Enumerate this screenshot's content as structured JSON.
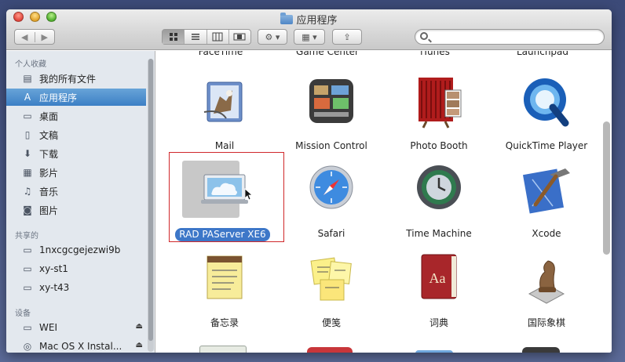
{
  "window": {
    "title": "应用程序"
  },
  "toolbar": {
    "back_glyph": "◀",
    "forward_glyph": "▶",
    "view_icons": [
      "icon-view-icon",
      "list-view-icon",
      "column-view-icon",
      "coverflow-view-icon"
    ],
    "action_glyph": "⚙ ▾",
    "arrange_glyph": "▦ ▾",
    "share_glyph": "⇪",
    "search_placeholder": ""
  },
  "sidebar": {
    "favorites_header": "个人收藏",
    "shared_header": "共享的",
    "devices_header": "设备",
    "items": [
      {
        "label": "我的所有文件",
        "icon": "all-files-icon"
      },
      {
        "label": "应用程序",
        "icon": "applications-icon"
      },
      {
        "label": "桌面",
        "icon": "desktop-icon"
      },
      {
        "label": "文稿",
        "icon": "documents-icon"
      },
      {
        "label": "下载",
        "icon": "downloads-icon"
      },
      {
        "label": "影片",
        "icon": "movies-icon"
      },
      {
        "label": "音乐",
        "icon": "music-icon"
      },
      {
        "label": "图片",
        "icon": "pictures-icon"
      }
    ],
    "shared": [
      {
        "label": "1nxcgcgejezwi9b",
        "icon": "computer-icon"
      },
      {
        "label": "xy-st1",
        "icon": "computer-icon"
      },
      {
        "label": "xy-t43",
        "icon": "computer-icon"
      }
    ],
    "devices": [
      {
        "label": "WEI",
        "icon": "disk-icon"
      },
      {
        "label": "Mac OS X Instal...",
        "icon": "dvd-icon"
      }
    ]
  },
  "content": {
    "cut_labels": [
      "FaceTime",
      "Game Center",
      "iTunes",
      "Launchpad"
    ],
    "apps": [
      {
        "label": "Mail",
        "icon": "mail-icon"
      },
      {
        "label": "Mission Control",
        "icon": "mission-control-icon"
      },
      {
        "label": "Photo Booth",
        "icon": "photo-booth-icon"
      },
      {
        "label": "QuickTime Player",
        "icon": "quicktime-icon"
      },
      {
        "label": "RAD PAServer XE6",
        "icon": "paserver-icon"
      },
      {
        "label": "Safari",
        "icon": "safari-icon"
      },
      {
        "label": "Time Machine",
        "icon": "time-machine-icon"
      },
      {
        "label": "Xcode",
        "icon": "xcode-icon"
      },
      {
        "label": "备忘录",
        "icon": "notes-icon"
      },
      {
        "label": "便笺",
        "icon": "stickies-icon"
      },
      {
        "label": "词典",
        "icon": "dictionary-icon"
      },
      {
        "label": "国际象棋",
        "icon": "chess-icon"
      }
    ],
    "selected_app": "RAD PAServer XE6"
  },
  "colors": {
    "selection_blue": "#3d77c8",
    "highlight_frame": "#d0282b",
    "sidebar_bg": "#e3e8ee"
  }
}
